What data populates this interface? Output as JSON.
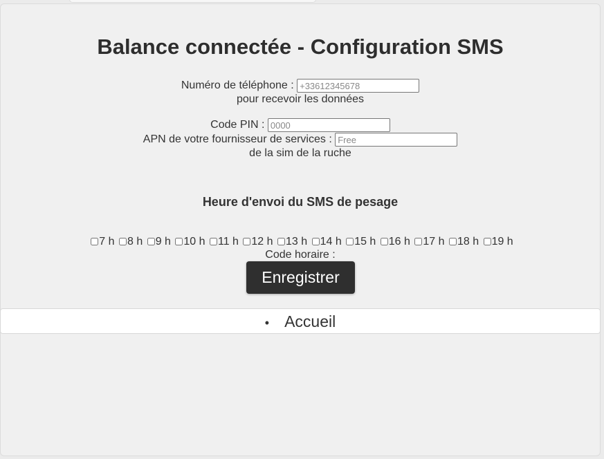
{
  "page": {
    "title": "Balance connectée - Configuration SMS"
  },
  "form": {
    "phone_label": "Numéro de téléphone :",
    "phone_placeholder": "+33612345678",
    "phone_hint": "pour recevoir les données",
    "pin_label": "Code PIN :",
    "pin_placeholder": "0000",
    "apn_label": "APN de votre fournisseur de services :",
    "apn_placeholder": "Free",
    "apn_hint": "de la sim de la ruche",
    "schedule_heading": "Heure d'envoi du SMS de pesage",
    "hours": [
      {
        "label": "7 h",
        "checked": false
      },
      {
        "label": "8 h",
        "checked": false
      },
      {
        "label": "9 h",
        "checked": false
      },
      {
        "label": "10 h",
        "checked": false
      },
      {
        "label": "11 h",
        "checked": false
      },
      {
        "label": "12 h",
        "checked": false
      },
      {
        "label": "13 h",
        "checked": false
      },
      {
        "label": "14 h",
        "checked": false
      },
      {
        "label": "15 h",
        "checked": false
      },
      {
        "label": "16 h",
        "checked": false
      },
      {
        "label": "17 h",
        "checked": false
      },
      {
        "label": "18 h",
        "checked": false
      },
      {
        "label": "19 h",
        "checked": false
      }
    ],
    "code_label": "Code horaire :",
    "save_label": "Enregistrer"
  },
  "nav": {
    "items": [
      {
        "label": "Accueil"
      }
    ]
  },
  "colors": {
    "button_bg": "#2f2f2f",
    "page_bg": "#f0f0f0",
    "text": "#333333"
  }
}
